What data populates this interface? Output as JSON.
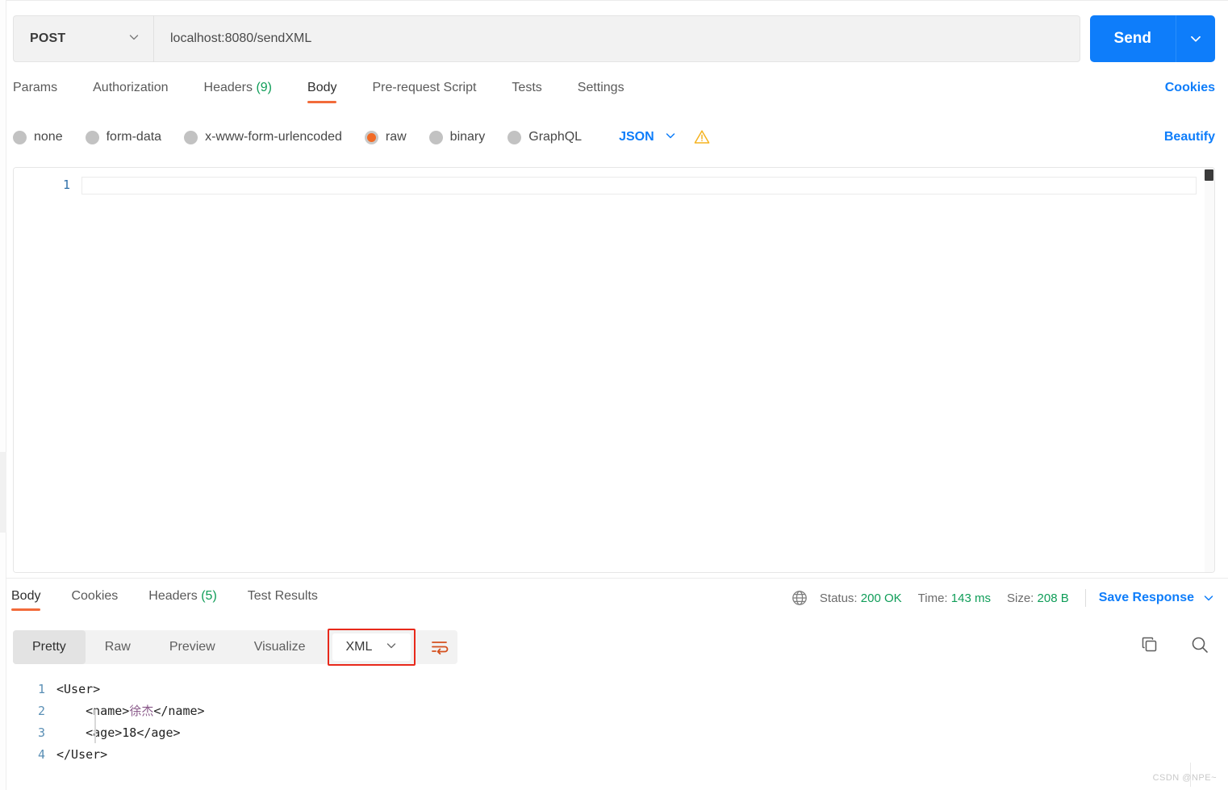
{
  "request": {
    "method": "POST",
    "method_caret_icon": "chevron-down-icon",
    "url": "localhost:8080/sendXML",
    "url_placeholder": "Enter request URL",
    "send_label": "Send",
    "send_caret_icon": "chevron-down-icon",
    "tabs": [
      {
        "label": "Params",
        "active": false
      },
      {
        "label": "Authorization",
        "active": false
      },
      {
        "label": "Headers",
        "count": "(9)",
        "active": false
      },
      {
        "label": "Body",
        "active": true
      },
      {
        "label": "Pre-request Script",
        "active": false
      },
      {
        "label": "Tests",
        "active": false
      },
      {
        "label": "Settings",
        "active": false
      }
    ],
    "cookies_label": "Cookies",
    "body_types": [
      {
        "label": "none",
        "selected": false
      },
      {
        "label": "form-data",
        "selected": false
      },
      {
        "label": "x-www-form-urlencoded",
        "selected": false
      },
      {
        "label": "raw",
        "selected": true
      },
      {
        "label": "binary",
        "selected": false
      },
      {
        "label": "GraphQL",
        "selected": false
      }
    ],
    "format": "JSON",
    "format_caret_icon": "chevron-down-icon",
    "warning_icon": "warning-triangle-icon",
    "beautify_label": "Beautify",
    "editor": {
      "line_number": "1",
      "content": ""
    }
  },
  "response": {
    "tabs": [
      {
        "label": "Body",
        "active": true
      },
      {
        "label": "Cookies",
        "active": false
      },
      {
        "label": "Headers",
        "count": "(5)",
        "active": false
      },
      {
        "label": "Test Results",
        "active": false
      }
    ],
    "status": {
      "globe_icon": "globe-icon",
      "status_label": "Status:",
      "status_value": "200 OK",
      "time_label": "Time:",
      "time_value": "143 ms",
      "size_label": "Size:",
      "size_value": "208 B",
      "save_response_label": "Save Response",
      "save_caret_icon": "chevron-down-icon"
    },
    "view_tabs": [
      {
        "label": "Pretty",
        "active": true
      },
      {
        "label": "Raw",
        "active": false
      },
      {
        "label": "Preview",
        "active": false
      },
      {
        "label": "Visualize",
        "active": false
      }
    ],
    "format": "XML",
    "format_caret_icon": "chevron-down-icon",
    "wrap_icon": "word-wrap-icon",
    "copy_icon": "copy-icon",
    "search_icon": "search-icon",
    "code": [
      {
        "num": "1",
        "text": "<User>"
      },
      {
        "num": "2",
        "text_pre": "    <name>",
        "cjk": "徐杰",
        "text_post": "</name>"
      },
      {
        "num": "3",
        "text": "    <age>18</age>"
      },
      {
        "num": "4",
        "text": "</User>"
      }
    ]
  },
  "watermark": "CSDN @NPE~",
  "colors": {
    "accent_blue": "#0e7dfa",
    "accent_orange": "#f26b3a",
    "status_green": "#0f9d58",
    "highlight_red": "#e8291b"
  }
}
